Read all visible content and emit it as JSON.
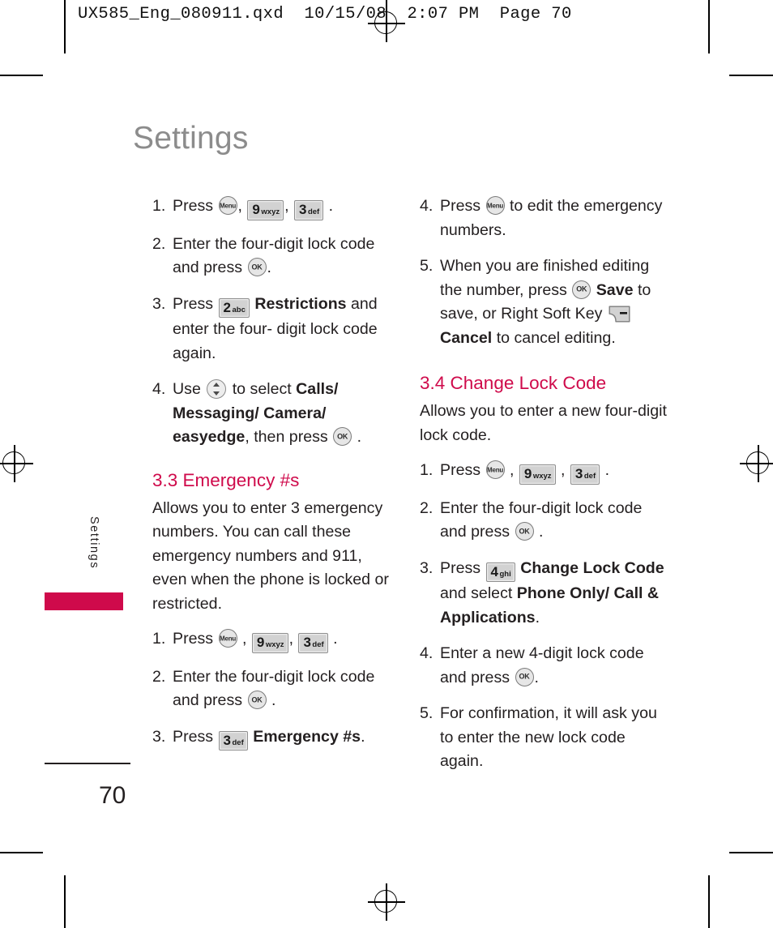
{
  "prepress": {
    "file_header": "UX585_Eng_080911.qxd  10/15/08  2:07 PM  Page 70"
  },
  "page": {
    "title": "Settings",
    "side_tab_label": "Settings",
    "side_tab_color": "#cf0a4b",
    "number": "70",
    "accent_color": "#cf0a4b",
    "title_color": "#8c8c8c"
  },
  "icons": {
    "menu": {
      "name": "menu-key-icon",
      "label": "Menu"
    },
    "ok": {
      "name": "ok-key-icon",
      "label": "OK"
    },
    "nav": {
      "name": "navigation-key-icon",
      "label": "Up/Down Navigation Key"
    },
    "soft_right": {
      "name": "right-soft-key-icon",
      "label": "Right Soft Key"
    },
    "key2": {
      "digit": "2",
      "letters": "abc"
    },
    "key3": {
      "digit": "3",
      "letters": "def"
    },
    "key4": {
      "digit": "4",
      "letters": "ghi"
    },
    "key9": {
      "digit": "9",
      "letters": "wxyz"
    }
  },
  "left_column": {
    "steps_restrictions": [
      {
        "num": "1.",
        "parts": [
          {
            "t": "text",
            "v": "Press "
          },
          {
            "t": "key",
            "v": "menu"
          },
          {
            "t": "text",
            "v": ", "
          },
          {
            "t": "key",
            "v": "key9"
          },
          {
            "t": "text",
            "v": ", "
          },
          {
            "t": "key",
            "v": "key3"
          },
          {
            "t": "text",
            "v": " ."
          }
        ]
      },
      {
        "num": "2.",
        "parts": [
          {
            "t": "text",
            "v": "Enter the four-digit lock code and press "
          },
          {
            "t": "key",
            "v": "ok"
          },
          {
            "t": "text",
            "v": "."
          }
        ]
      },
      {
        "num": "3.",
        "parts": [
          {
            "t": "text",
            "v": "Press "
          },
          {
            "t": "key",
            "v": "key2"
          },
          {
            "t": "bold",
            "v": " Restrictions"
          },
          {
            "t": "text",
            "v": " and enter the four- digit lock code again."
          }
        ]
      },
      {
        "num": "4.",
        "parts": [
          {
            "t": "text",
            "v": "Use "
          },
          {
            "t": "key",
            "v": "nav"
          },
          {
            "t": "text",
            "v": " to select "
          },
          {
            "t": "bold",
            "v": "Calls/ Messaging/ Camera/ easyedge"
          },
          {
            "t": "text",
            "v": ", then press "
          },
          {
            "t": "key",
            "v": "ok"
          },
          {
            "t": "text",
            "v": " ."
          }
        ]
      }
    ],
    "section": {
      "heading": "3.3 Emergency #s",
      "intro": "Allows you to enter 3 emergency numbers. You can call these emergency numbers and 911, even when the phone is locked or restricted.",
      "steps": [
        {
          "num": "1.",
          "parts": [
            {
              "t": "text",
              "v": "Press "
            },
            {
              "t": "key",
              "v": "menu"
            },
            {
              "t": "text",
              "v": " , "
            },
            {
              "t": "key",
              "v": "key9"
            },
            {
              "t": "text",
              "v": ", "
            },
            {
              "t": "key",
              "v": "key3"
            },
            {
              "t": "text",
              "v": " ."
            }
          ]
        },
        {
          "num": "2.",
          "parts": [
            {
              "t": "text",
              "v": "Enter the four-digit lock code and press "
            },
            {
              "t": "key",
              "v": "ok"
            },
            {
              "t": "text",
              "v": " ."
            }
          ]
        },
        {
          "num": "3.",
          "parts": [
            {
              "t": "text",
              "v": "Press "
            },
            {
              "t": "key",
              "v": "key3"
            },
            {
              "t": "bold",
              "v": " Emergency #s"
            },
            {
              "t": "text",
              "v": "."
            }
          ]
        }
      ]
    }
  },
  "right_column": {
    "steps_continued": [
      {
        "num": "4.",
        "parts": [
          {
            "t": "text",
            "v": "Press "
          },
          {
            "t": "key",
            "v": "menu"
          },
          {
            "t": "text",
            "v": " to edit the emergency numbers."
          }
        ]
      },
      {
        "num": "5.",
        "parts": [
          {
            "t": "text",
            "v": "When you are finished editing the number, press "
          },
          {
            "t": "key",
            "v": "ok"
          },
          {
            "t": "bold",
            "v": " Save"
          },
          {
            "t": "text",
            "v": " to save, or Right Soft Key "
          },
          {
            "t": "key",
            "v": "soft_right"
          },
          {
            "t": "bold",
            "v": " Cancel"
          },
          {
            "t": "text",
            "v": " to cancel editing."
          }
        ]
      }
    ],
    "section": {
      "heading": "3.4 Change Lock Code",
      "intro": "Allows you to enter a new four-digit lock code.",
      "steps": [
        {
          "num": "1.",
          "parts": [
            {
              "t": "text",
              "v": "Press "
            },
            {
              "t": "key",
              "v": "menu"
            },
            {
              "t": "text",
              "v": " , "
            },
            {
              "t": "key",
              "v": "key9"
            },
            {
              "t": "text",
              "v": " , "
            },
            {
              "t": "key",
              "v": "key3"
            },
            {
              "t": "text",
              "v": " ."
            }
          ]
        },
        {
          "num": "2.",
          "parts": [
            {
              "t": "text",
              "v": "Enter the four-digit lock code and press "
            },
            {
              "t": "key",
              "v": "ok"
            },
            {
              "t": "text",
              "v": " ."
            }
          ]
        },
        {
          "num": "3.",
          "parts": [
            {
              "t": "text",
              "v": "Press "
            },
            {
              "t": "key",
              "v": "key4"
            },
            {
              "t": "bold",
              "v": " Change Lock Code"
            },
            {
              "t": "text",
              "v": " and select "
            },
            {
              "t": "bold",
              "v": "Phone Only/ Call & Applications"
            },
            {
              "t": "text",
              "v": "."
            }
          ]
        },
        {
          "num": "4.",
          "parts": [
            {
              "t": "text",
              "v": "Enter a new 4-digit lock code and press "
            },
            {
              "t": "key",
              "v": "ok"
            },
            {
              "t": "text",
              "v": "."
            }
          ]
        },
        {
          "num": "5.",
          "parts": [
            {
              "t": "text",
              "v": "For confirmation, it will ask you to enter the new lock code again."
            }
          ]
        }
      ]
    }
  }
}
